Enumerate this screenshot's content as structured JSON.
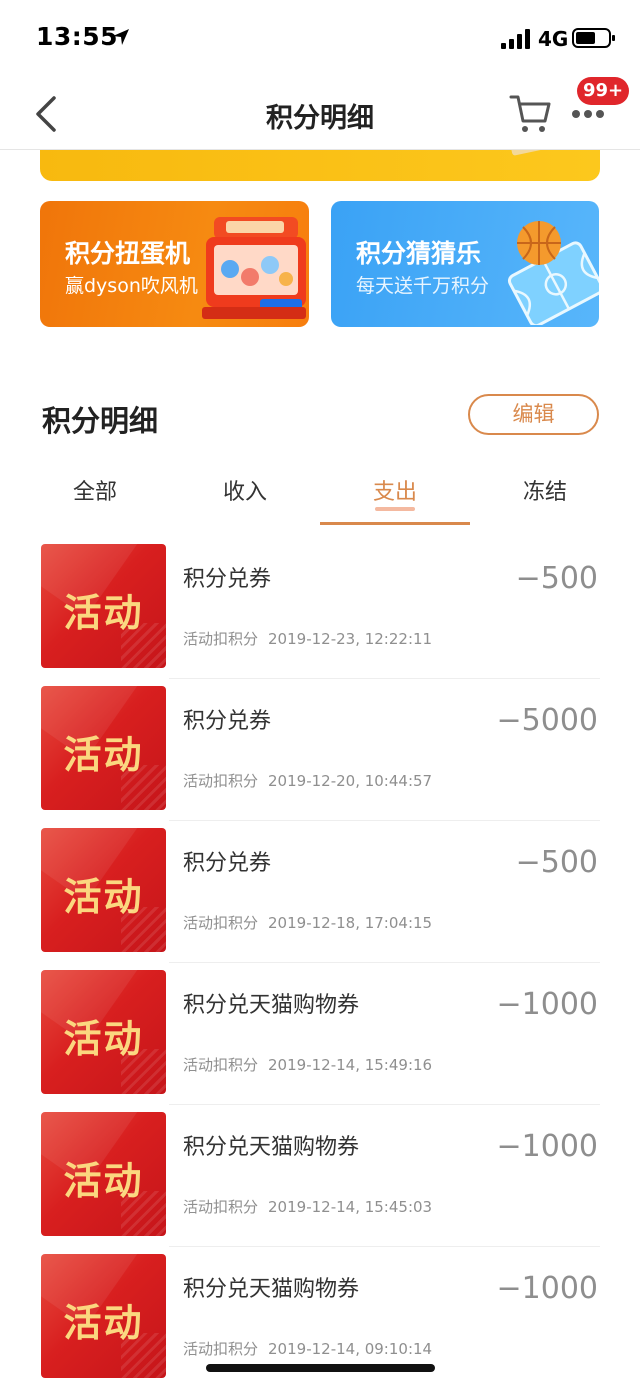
{
  "status_bar": {
    "time": "13:55",
    "network": "4G",
    "icons": [
      "location-arrow-icon",
      "signal-icon",
      "battery-icon"
    ]
  },
  "nav": {
    "title": "积分明细",
    "cart_badge": "99+",
    "icons": [
      "chevron-left-icon",
      "cart-icon",
      "more-icon"
    ]
  },
  "promos": [
    {
      "title": "积分扭蛋机",
      "subtitle": "赢dyson吹风机",
      "color": "#f28010"
    },
    {
      "title": "积分猜猜乐",
      "subtitle": "每天送千万积分",
      "color": "#4aaef8"
    }
  ],
  "section": {
    "title": "积分明细",
    "edit_label": "编辑"
  },
  "tabs": [
    {
      "label": "全部",
      "active": false
    },
    {
      "label": "收入",
      "active": false
    },
    {
      "label": "支出",
      "active": true
    },
    {
      "label": "冻结",
      "active": false
    }
  ],
  "accent_color": "#d9894c",
  "records": [
    {
      "badge": "活动",
      "title": "积分兑券",
      "amount": "−500",
      "type": "活动扣积分",
      "time": "2019-12-23, 12:22:11"
    },
    {
      "badge": "活动",
      "title": "积分兑券",
      "amount": "−5000",
      "type": "活动扣积分",
      "time": "2019-12-20, 10:44:57"
    },
    {
      "badge": "活动",
      "title": "积分兑券",
      "amount": "−500",
      "type": "活动扣积分",
      "time": "2019-12-18, 17:04:15"
    },
    {
      "badge": "活动",
      "title": "积分兑天猫购物券",
      "amount": "−1000",
      "type": "活动扣积分",
      "time": "2019-12-14, 15:49:16"
    },
    {
      "badge": "活动",
      "title": "积分兑天猫购物券",
      "amount": "−1000",
      "type": "活动扣积分",
      "time": "2019-12-14, 15:45:03"
    },
    {
      "badge": "活动",
      "title": "积分兑天猫购物券",
      "amount": "−1000",
      "type": "活动扣积分",
      "time": "2019-12-14, 09:10:14"
    }
  ]
}
